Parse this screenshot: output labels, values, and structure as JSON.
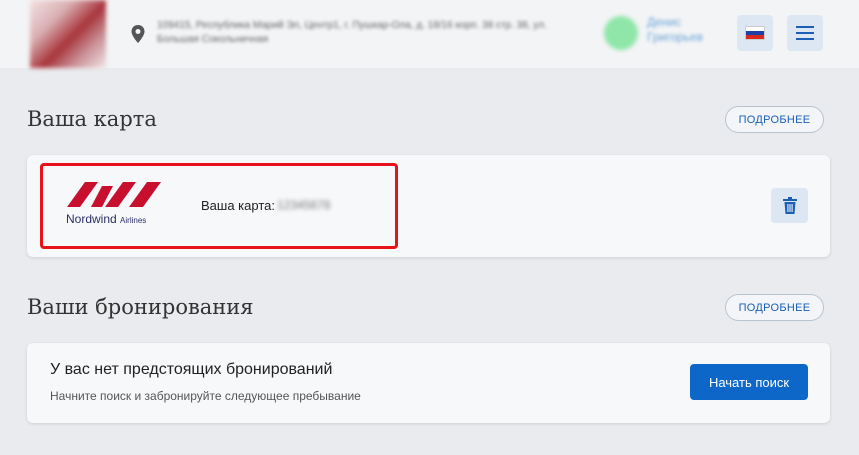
{
  "header": {
    "address": "109415, Республика Марий Эл, Центр1, г. Пушкар-Ола, д. 18/16 корп. 38 стр. 38, ул. Большая Сокольничная",
    "user_name": "Денис Григорьев",
    "lang_flag_colors": [
      "#ffffff",
      "#1c3fa8",
      "#d52b1e"
    ],
    "icons": [
      "location-pin-icon",
      "russian-flag-icon",
      "hamburger-menu-icon"
    ]
  },
  "loyalty": {
    "title": "Ваша карта",
    "more_label": "ПОДРОБНЕЕ",
    "logo_brand": "Nordwind",
    "logo_suffix": "Airlines",
    "card_label": "Ваша карта:",
    "card_number": "12345678",
    "delete_icon": "trash-icon"
  },
  "bookings": {
    "title": "Ваши бронирования",
    "more_label": "ПОДРОБНЕЕ",
    "empty_title": "У вас нет предстоящих бронирований",
    "empty_subtitle": "Начните поиск и забронируйте следующее пребывание",
    "search_label": "Начать поиск"
  },
  "colors": {
    "accent": "#0d67c9",
    "highlight": "#e8121a",
    "brand_red": "#c8102e"
  }
}
